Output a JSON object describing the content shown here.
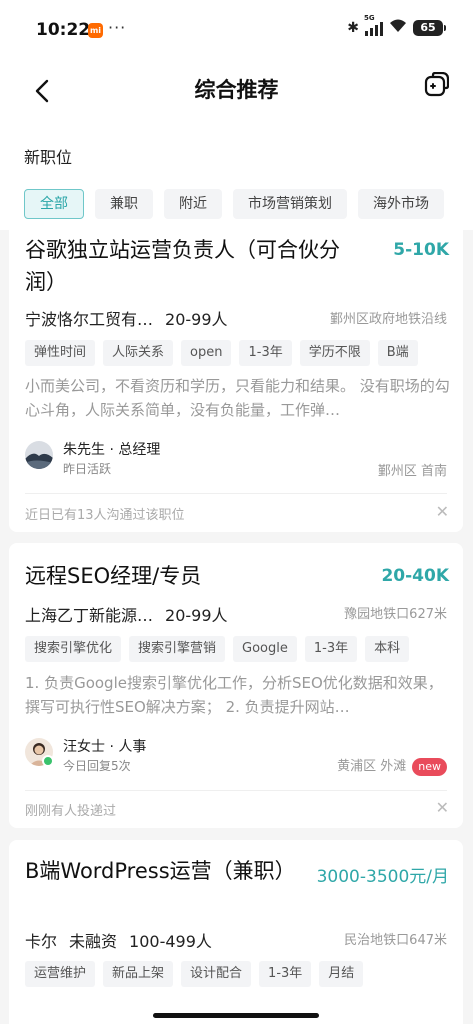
{
  "status_bar": {
    "time": "10:22",
    "mi_label": "mi",
    "dots": "···",
    "signal_label": "5G",
    "battery": "65"
  },
  "nav": {
    "title": "综合推荐"
  },
  "section": {
    "label": "新职位"
  },
  "filters": [
    "全部",
    "兼职",
    "附近",
    "市场营销策划",
    "海外市场"
  ],
  "jobs": [
    {
      "title": "谷歌独立站运营负责人（可合伙分润）",
      "salary": "5-10K",
      "company": "宁波恪尔工贸有…",
      "size": "20-99人",
      "location": "鄞州区政府地铁沿线",
      "tags": [
        "弹性时间",
        "人际关系",
        "open",
        "1-3年",
        "学历不限",
        "B端"
      ],
      "desc": "小而美公司，不看资历和学历，只看能力和结果。 没有职场的勾心斗角，人际关系简单，没有负能量，工作弹…",
      "recruiter": "朱先生 · 总经理",
      "recruiter_status": "昨日活跃",
      "area": "鄞州区 首南",
      "footer": "近日已有13人沟通过该职位"
    },
    {
      "title": "远程SEO经理/专员",
      "salary": "20-40K",
      "company": "上海乙丁新能源…",
      "size": "20-99人",
      "location": "豫园地铁口627米",
      "tags": [
        "搜索引擎优化",
        "搜索引擎营销",
        "Google",
        "1-3年",
        "本科"
      ],
      "desc": "1. 负责Google搜索引擎优化工作，分析SEO优化数据和效果，撰写可执行性SEO解决方案； 2. 负责提升网站…",
      "recruiter": "汪女士 · 人事",
      "recruiter_status": "今日回复5次",
      "area": "黄浦区 外滩",
      "badge": "new",
      "footer": "刚刚有人投递过"
    },
    {
      "title": "B端WordPress运营（兼职）",
      "salary": "3000-3500元/月",
      "company": "卡尔",
      "funding": "未融资",
      "size": "100-499人",
      "location": "民治地铁口647米",
      "tags": [
        "运营维护",
        "新品上架",
        "设计配合",
        "1-3年",
        "月结"
      ]
    }
  ],
  "colors": {
    "accent": "#2fa7a8",
    "new_badge": "#e94b5b"
  }
}
